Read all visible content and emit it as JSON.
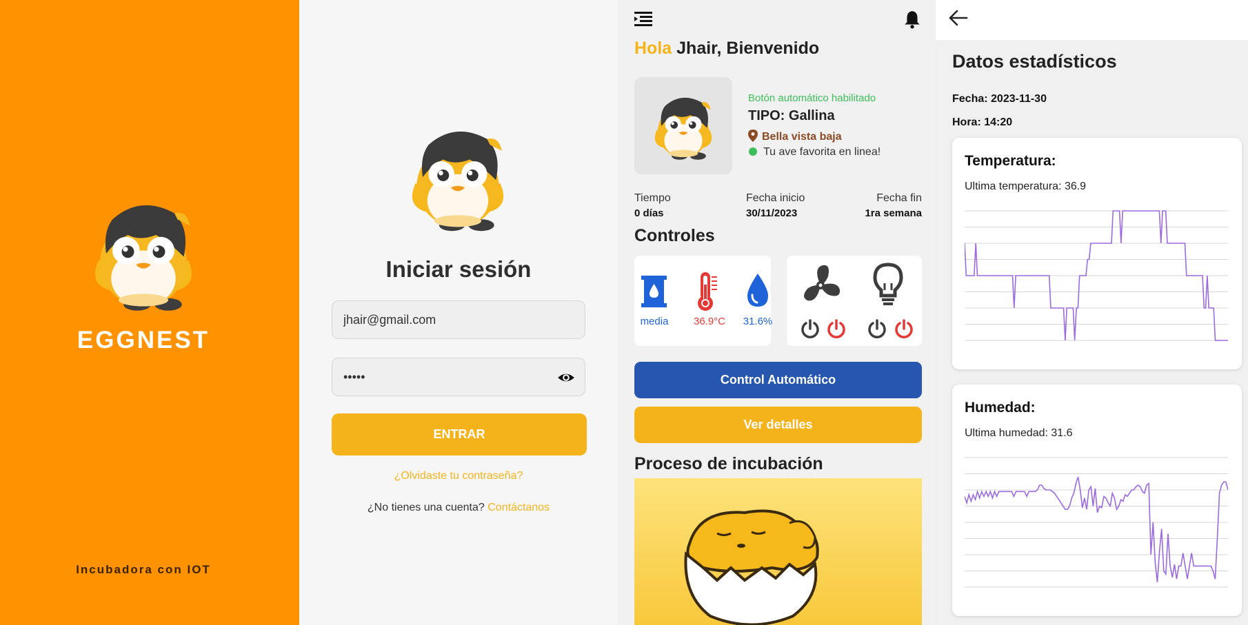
{
  "splash": {
    "brand": "EGGNEST",
    "tagline": "Incubadora con IOT",
    "background": "#FE9201"
  },
  "login": {
    "title": "Iniciar sesión",
    "email_value": "jhair@gmail.com",
    "password_value": "•••••",
    "enter_label": "ENTRAR",
    "forgot_label": "¿Olvidaste tu contraseña?",
    "no_account_label": "¿No tienes una cuenta?",
    "contact_label": "Contáctanos"
  },
  "dashboard": {
    "greeting_hola": "Hola",
    "greeting_rest": "Jhair, Bienvenido",
    "auto_status": "Botón automático habilitado",
    "tipo": "TIPO: Gallina",
    "location": "Bella vista baja",
    "online_status": "Tu ave favorita en linea!",
    "tiempo_label": "Tiempo",
    "tiempo_value": "0 días",
    "fecha_inicio_label": "Fecha inicio",
    "fecha_inicio_value": "30/11/2023",
    "fecha_fin_label": "Fecha fin",
    "fecha_fin_value": "1ra semana",
    "controls_title": "Controles",
    "water_level": "media",
    "temperature": "36.9°C",
    "humidity": "31.6%",
    "auto_control_label": "Control Automático",
    "details_label": "Ver detalles",
    "process_title": "Proceso de incubación",
    "colors": {
      "yellow": "#F4B31B",
      "blue": "#2656AE",
      "green": "#3DBE5A",
      "red": "#E53935"
    }
  },
  "stats": {
    "title": "Datos estadísticos",
    "fecha": "Fecha: 2023-11-30",
    "hora": "Hora: 14:20",
    "temp_card_title": "Temperatura:",
    "temp_last": "Ultima temperatura: 36.9",
    "hum_card_title": "Humedad:",
    "hum_last": "Ultima humedad: 31.6",
    "line_color": "#9A6AE0"
  },
  "chart_data": [
    {
      "type": "line",
      "title": "Temperatura:",
      "series": [
        {
          "values": [
            6,
            4,
            4,
            4,
            4,
            4,
            4,
            6,
            4,
            4,
            4,
            4,
            4,
            4,
            4,
            4,
            4,
            4,
            4,
            4,
            4,
            4,
            4,
            4,
            4,
            4,
            4,
            4,
            4,
            4,
            4,
            2,
            4,
            4,
            4,
            4,
            4,
            4,
            4,
            4,
            4,
            4,
            4,
            4,
            4,
            4,
            4,
            4,
            4,
            4,
            4,
            4,
            4,
            4,
            2,
            2,
            2,
            2,
            2,
            2,
            2,
            2,
            2,
            0,
            2,
            2,
            2,
            2,
            2,
            0,
            2,
            2,
            4,
            4,
            4,
            4,
            4,
            5,
            5,
            6,
            6,
            6,
            6,
            6,
            6,
            6,
            6,
            6,
            6,
            6,
            6,
            6,
            6,
            8,
            8,
            8,
            8,
            8,
            6,
            8,
            8,
            8,
            8,
            8,
            8,
            8,
            8,
            8,
            8,
            8,
            8,
            8,
            8,
            8,
            8,
            8,
            8,
            8,
            8,
            8,
            8,
            8,
            8,
            6,
            8,
            8,
            8,
            6,
            6,
            6,
            6,
            6,
            6,
            6,
            6,
            6,
            6,
            6,
            6,
            4,
            4,
            4,
            4,
            4,
            4,
            4,
            4,
            4,
            4,
            4,
            2,
            2,
            4,
            2,
            2,
            2,
            2,
            0,
            0,
            0,
            0,
            0,
            0,
            0,
            0,
            0
          ]
        }
      ],
      "grid": true
    },
    {
      "type": "line",
      "title": "Humedad:",
      "series": [
        {
          "values": [
            5.6,
            5.2,
            5.7,
            5.3,
            5.7,
            5.4,
            5.9,
            5.5,
            5.9,
            5.6,
            5.9,
            5.6,
            5.9,
            5.5,
            5.9,
            5.6,
            5.9,
            5.9,
            5.9,
            5.9,
            5.9,
            5.9,
            5.9,
            5.6,
            5.9,
            5.9,
            5.9,
            5.9,
            5.9,
            5.6,
            5.9,
            5.9,
            5.9,
            5.9,
            6.0,
            6.3,
            6.3,
            6.1,
            6.0,
            6.0,
            6.0,
            5.9,
            5.8,
            5.6,
            5.4,
            5.2,
            5.0,
            4.8,
            4.8,
            5.0,
            5.5,
            5.8,
            6.4,
            6.8,
            6.0,
            4.9,
            5.5,
            4.8,
            6.0,
            6.2,
            5.0,
            6.1,
            4.6,
            5.0,
            4.9,
            5.6,
            5.5,
            5.2,
            5.0,
            5.8,
            5.5,
            4.8,
            5.0,
            5.4,
            5.3,
            5.7,
            5.6,
            5.8,
            6.0,
            6.0,
            6.2,
            6.3,
            6.2,
            5.9,
            5.8,
            6.3,
            6.4,
            2.0,
            4.0,
            1.5,
            0.3,
            2.2,
            3.6,
            1.0,
            0.8,
            3.3,
            1.3,
            0.6,
            1.4,
            0.5,
            1.3,
            1.3,
            2.1,
            1.3,
            0.5,
            1.3,
            2.1,
            1.3,
            1.3,
            1.3,
            1.3,
            1.3,
            1.3,
            1.3,
            1.3,
            1.3,
            1.0,
            0.5,
            3.0,
            5.8,
            6.3,
            6.5,
            6.5,
            6.0
          ]
        }
      ],
      "grid": true
    }
  ]
}
